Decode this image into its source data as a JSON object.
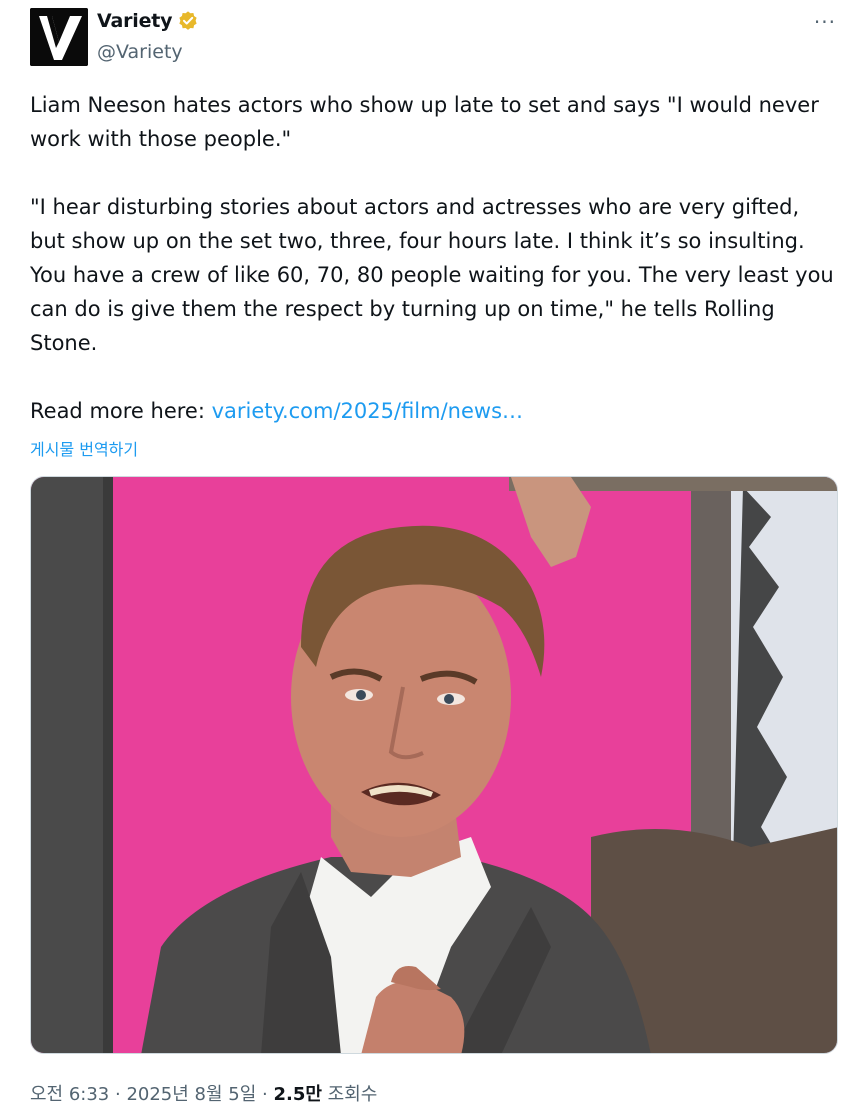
{
  "account": {
    "display_name": "Variety",
    "handle": "@Variety",
    "logo_letter": "V",
    "verified_color": "#e8b82a",
    "more_label": "···"
  },
  "tweet": {
    "paragraph_1": "Liam Neeson hates actors who show up late to set and says \"I would never work with those people.\"",
    "paragraph_2": "\"I hear disturbing stories about actors and actresses who are very gifted, but show up on the set two, three, four hours late. I think it’s so insulting. You have a crew of like 60, 70, 80 people waiting for you. The very least you can do is give them the respect by turning up on time,\" he tells Rolling Stone.",
    "read_more_prefix": "Read more here: ",
    "link_text": "variety.com/2025/film/news…",
    "translate_label": "게시물 번역하기"
  },
  "meta": {
    "time": "오전 6:33",
    "separator": " · ",
    "date": "2025년 8월 5일",
    "views_count": "2.5만",
    "views_label": " 조회수"
  },
  "colors": {
    "link": "#1d9bf0",
    "secondary_text": "#536471",
    "photo_background": "#e8409a"
  }
}
